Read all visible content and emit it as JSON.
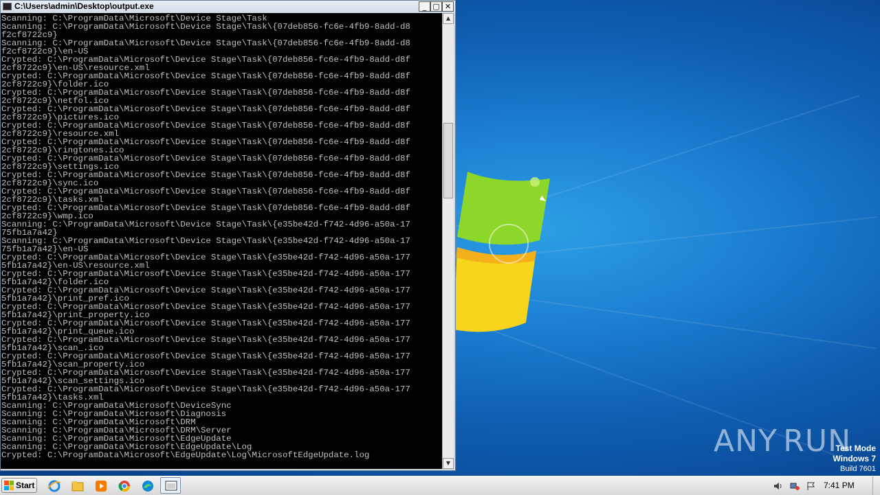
{
  "window": {
    "title": "C:\\Users\\admin\\Desktop\\output.exe",
    "buttons": {
      "minimize": "_",
      "maximize": "▢",
      "close": "✕"
    }
  },
  "console_lines": [
    "Scanning: C:\\ProgramData\\Microsoft\\Device Stage\\Task",
    "Scanning: C:\\ProgramData\\Microsoft\\Device Stage\\Task\\{07deb856-fc6e-4fb9-8add-d8",
    "f2cf8722c9}",
    "Scanning: C:\\ProgramData\\Microsoft\\Device Stage\\Task\\{07deb856-fc6e-4fb9-8add-d8",
    "f2cf8722c9}\\en-US",
    "Crypted: C:\\ProgramData\\Microsoft\\Device Stage\\Task\\{07deb856-fc6e-4fb9-8add-d8f",
    "2cf8722c9}\\en-US\\resource.xml",
    "Crypted: C:\\ProgramData\\Microsoft\\Device Stage\\Task\\{07deb856-fc6e-4fb9-8add-d8f",
    "2cf8722c9}\\folder.ico",
    "Crypted: C:\\ProgramData\\Microsoft\\Device Stage\\Task\\{07deb856-fc6e-4fb9-8add-d8f",
    "2cf8722c9}\\netfol.ico",
    "Crypted: C:\\ProgramData\\Microsoft\\Device Stage\\Task\\{07deb856-fc6e-4fb9-8add-d8f",
    "2cf8722c9}\\pictures.ico",
    "Crypted: C:\\ProgramData\\Microsoft\\Device Stage\\Task\\{07deb856-fc6e-4fb9-8add-d8f",
    "2cf8722c9}\\resource.xml",
    "Crypted: C:\\ProgramData\\Microsoft\\Device Stage\\Task\\{07deb856-fc6e-4fb9-8add-d8f",
    "2cf8722c9}\\ringtones.ico",
    "Crypted: C:\\ProgramData\\Microsoft\\Device Stage\\Task\\{07deb856-fc6e-4fb9-8add-d8f",
    "2cf8722c9}\\settings.ico",
    "Crypted: C:\\ProgramData\\Microsoft\\Device Stage\\Task\\{07deb856-fc6e-4fb9-8add-d8f",
    "2cf8722c9}\\sync.ico",
    "Crypted: C:\\ProgramData\\Microsoft\\Device Stage\\Task\\{07deb856-fc6e-4fb9-8add-d8f",
    "2cf8722c9}\\tasks.xml",
    "Crypted: C:\\ProgramData\\Microsoft\\Device Stage\\Task\\{07deb856-fc6e-4fb9-8add-d8f",
    "2cf8722c9}\\wmp.ico",
    "Scanning: C:\\ProgramData\\Microsoft\\Device Stage\\Task\\{e35be42d-f742-4d96-a50a-17",
    "75fb1a7a42}",
    "Scanning: C:\\ProgramData\\Microsoft\\Device Stage\\Task\\{e35be42d-f742-4d96-a50a-17",
    "75fb1a7a42}\\en-US",
    "Crypted: C:\\ProgramData\\Microsoft\\Device Stage\\Task\\{e35be42d-f742-4d96-a50a-177",
    "5fb1a7a42}\\en-US\\resource.xml",
    "Crypted: C:\\ProgramData\\Microsoft\\Device Stage\\Task\\{e35be42d-f742-4d96-a50a-177",
    "5fb1a7a42}\\folder.ico",
    "Crypted: C:\\ProgramData\\Microsoft\\Device Stage\\Task\\{e35be42d-f742-4d96-a50a-177",
    "5fb1a7a42}\\print_pref.ico",
    "Crypted: C:\\ProgramData\\Microsoft\\Device Stage\\Task\\{e35be42d-f742-4d96-a50a-177",
    "5fb1a7a42}\\print_property.ico",
    "Crypted: C:\\ProgramData\\Microsoft\\Device Stage\\Task\\{e35be42d-f742-4d96-a50a-177",
    "5fb1a7a42}\\print_queue.ico",
    "Crypted: C:\\ProgramData\\Microsoft\\Device Stage\\Task\\{e35be42d-f742-4d96-a50a-177",
    "5fb1a7a42}\\scan_.ico",
    "Crypted: C:\\ProgramData\\Microsoft\\Device Stage\\Task\\{e35be42d-f742-4d96-a50a-177",
    "5fb1a7a42}\\scan_property.ico",
    "Crypted: C:\\ProgramData\\Microsoft\\Device Stage\\Task\\{e35be42d-f742-4d96-a50a-177",
    "5fb1a7a42}\\scan_settings.ico",
    "Crypted: C:\\ProgramData\\Microsoft\\Device Stage\\Task\\{e35be42d-f742-4d96-a50a-177",
    "5fb1a7a42}\\tasks.xml",
    "Scanning: C:\\ProgramData\\Microsoft\\DeviceSync",
    "Scanning: C:\\ProgramData\\Microsoft\\Diagnosis",
    "Scanning: C:\\ProgramData\\Microsoft\\DRM",
    "Scanning: C:\\ProgramData\\Microsoft\\DRM\\Server",
    "Scanning: C:\\ProgramData\\Microsoft\\EdgeUpdate",
    "Scanning: C:\\ProgramData\\Microsoft\\EdgeUpdate\\Log",
    "Crypted: C:\\ProgramData\\Microsoft\\EdgeUpdate\\Log\\MicrosoftEdgeUpdate.log"
  ],
  "watermark": {
    "left": "ANY",
    "right": "RUN"
  },
  "test_mode": {
    "line1": "Test Mode",
    "line2": "Windows 7",
    "line3": "Build 7601"
  },
  "taskbar": {
    "start_label": "Start",
    "icons": [
      "ie-icon",
      "explorer-icon",
      "media-player-icon",
      "chrome-icon",
      "edge-icon",
      "console-app-icon"
    ],
    "clock": "7:41 PM"
  },
  "colors": {
    "console_bg": "#000000",
    "console_fg": "#c0c0c0",
    "desktop": "#1a78c8"
  }
}
